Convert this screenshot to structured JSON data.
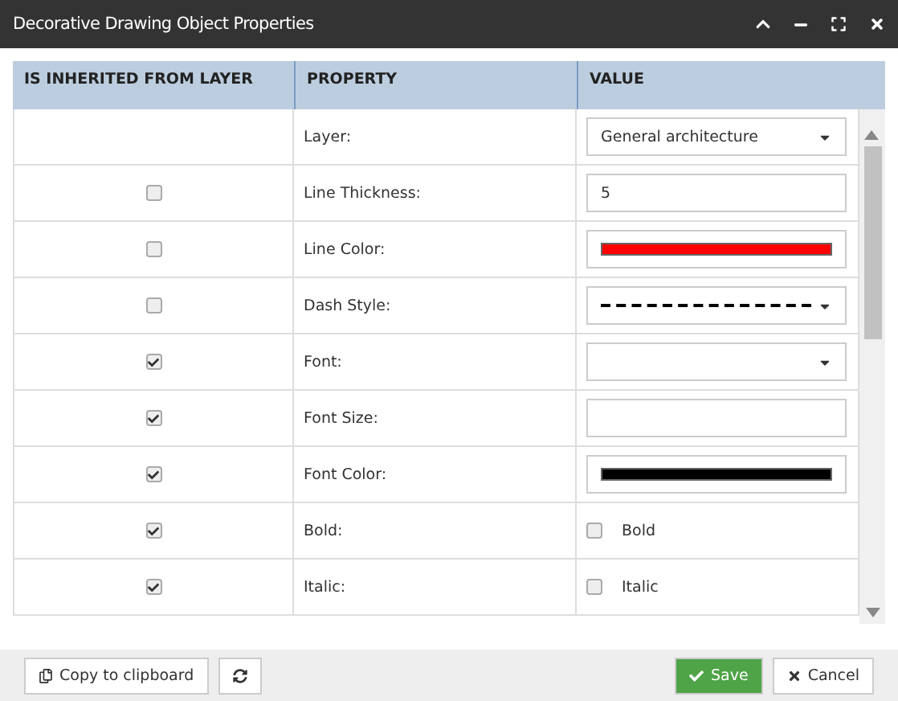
{
  "window": {
    "title": "Decorative Drawing Object Properties"
  },
  "table": {
    "columns": [
      "IS INHERITED FROM LAYER",
      "PROPERTY",
      "VALUE"
    ],
    "rows": [
      {
        "property": "Layer:",
        "kind": "select",
        "value": "General architecture"
      },
      {
        "inherited": false,
        "property": "Line Thickness:",
        "kind": "text",
        "value": "5"
      },
      {
        "inherited": false,
        "property": "Line Color:",
        "kind": "color",
        "color": "#ff0000"
      },
      {
        "inherited": false,
        "property": "Dash Style:",
        "kind": "dash"
      },
      {
        "inherited": true,
        "property": "Font:",
        "kind": "select",
        "value": ""
      },
      {
        "inherited": true,
        "property": "Font Size:",
        "kind": "text",
        "value": ""
      },
      {
        "inherited": true,
        "property": "Font Color:",
        "kind": "color",
        "color": "#000000"
      },
      {
        "inherited": true,
        "property": "Bold:",
        "kind": "checkbox",
        "value": "Bold",
        "checked": false
      },
      {
        "inherited": true,
        "property": "Italic:",
        "kind": "checkbox",
        "value": "Italic",
        "checked": false
      }
    ]
  },
  "footer": {
    "copy": "Copy to clipboard",
    "save": "Save",
    "cancel": "Cancel"
  }
}
